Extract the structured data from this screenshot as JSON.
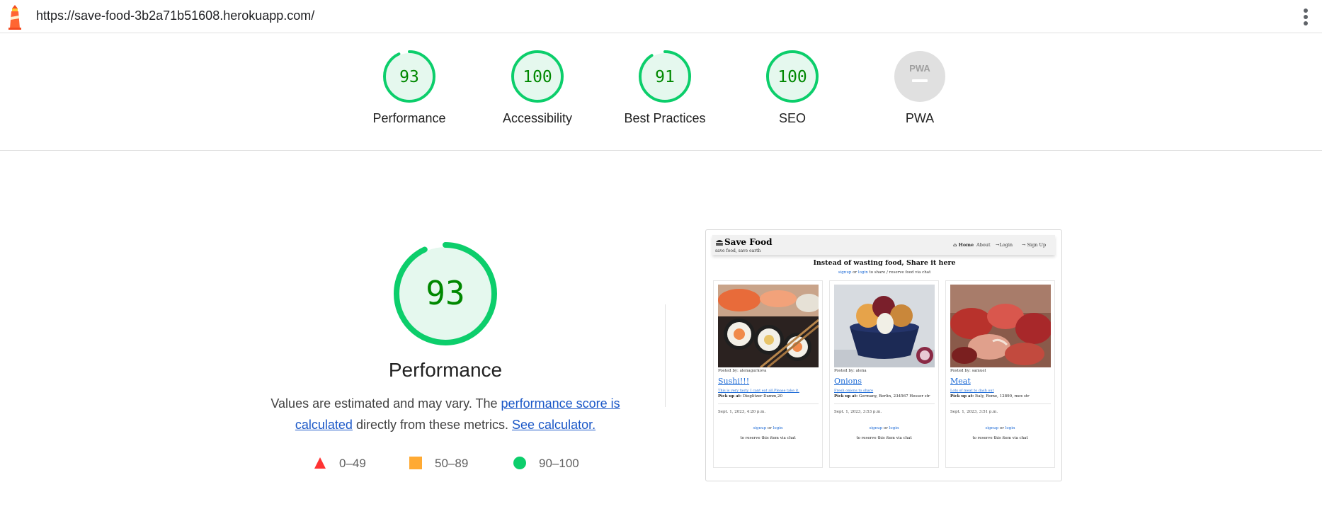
{
  "url": "https://save-food-3b2a71b51608.herokuapp.com/",
  "gauges": [
    {
      "label": "Performance",
      "value": "93",
      "score": 0.93
    },
    {
      "label": "Accessibility",
      "value": "100",
      "score": 1.0
    },
    {
      "label": "Best Practices",
      "value": "91",
      "score": 0.91
    },
    {
      "label": "SEO",
      "value": "100",
      "score": 1.0
    },
    {
      "label": "PWA",
      "badge": "PWA"
    }
  ],
  "main": {
    "score": "93",
    "score_fraction": 0.93,
    "title": "Performance",
    "desc_part1": "Values are estimated and may vary. The ",
    "desc_link1": "performance score is calculated",
    "desc_part2": " directly from these metrics. ",
    "desc_link2": "See calculator."
  },
  "legend": [
    {
      "range": "0–49",
      "shape": "triangle",
      "color": "#ff3333"
    },
    {
      "range": "50–89",
      "shape": "square",
      "color": "#ffaa33"
    },
    {
      "range": "90–100",
      "shape": "circle",
      "color": "#0cce6b"
    }
  ],
  "colors": {
    "pass": "#0cce6b",
    "pass_text": "#008800",
    "pass_fill": "#e5f8ee",
    "na": "#e0e0e0"
  },
  "screenshot": {
    "brand": "Save Food",
    "tagline": "save food, save earth",
    "menu": [
      "Home",
      "About",
      "Login",
      "Sign Up"
    ],
    "heading": "Instead of wasting food, Share it here",
    "sub_signup": "signup",
    "sub_or": "or",
    "sub_login": "login",
    "sub_rest": "to share / reserve food via chat",
    "cards": [
      {
        "posted": "Posted by: alenagurkova",
        "title": "Sushi!!!",
        "desc": "This is very tasty. I cant eat all.Please take it.",
        "pick_label": "Pick up at:",
        "pick": "Dieglitzer Damm,20",
        "date": "Sept. 1, 2023, 4:20 p.m.",
        "signup": "signup",
        "or": "or",
        "login": "login",
        "reserve": "to reserve this item via chat",
        "image": "sushi-photo"
      },
      {
        "posted": "Posted by: alena",
        "title": "Onions",
        "desc": "Fresh onions to share",
        "pick_label": "Pick up at:",
        "pick": "Germany, Berlin, 234567 Hesser str",
        "date": "Sept. 1, 2023, 3:53 p.m.",
        "signup": "signup",
        "or": "or",
        "login": "login",
        "reserve": "to reserve this item via chat",
        "image": "onions-photo"
      },
      {
        "posted": "Posted by: samuel",
        "title": "Meat",
        "desc": "Lots of meat to dash out",
        "pick_label": "Pick up at:",
        "pick": "Italy, Rome, 12890, mex str",
        "date": "Sept. 1, 2023, 3:51 p.m.",
        "signup": "signup",
        "or": "or",
        "login": "login",
        "reserve": "to reserve this item via chat",
        "image": "meat-photo"
      }
    ]
  }
}
